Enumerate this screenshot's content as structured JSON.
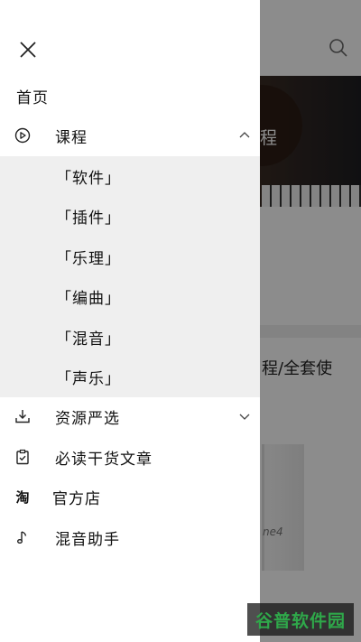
{
  "background": {
    "banner_text": "程",
    "card_title": "程/全套使",
    "box_label": "ne4"
  },
  "drawer": {
    "close_icon": "close-icon",
    "home": {
      "label": "首页"
    },
    "courses": {
      "label": "课程",
      "icon": "play-circle-icon",
      "expanded": true
    },
    "course_subitems": [
      "「软件」",
      "「插件」",
      "「乐理」",
      "「编曲」",
      "「混音」",
      "「声乐」"
    ],
    "resources": {
      "label": "资源严选",
      "icon": "download-icon"
    },
    "articles": {
      "label": "必读干货文章",
      "icon": "clipboard-check-icon"
    },
    "shop": {
      "label": "官方店",
      "icon_text": "淘"
    },
    "mixing": {
      "label": "混音助手",
      "icon": "music-note-icon"
    }
  },
  "watermark": {
    "text": "谷普软件园"
  }
}
